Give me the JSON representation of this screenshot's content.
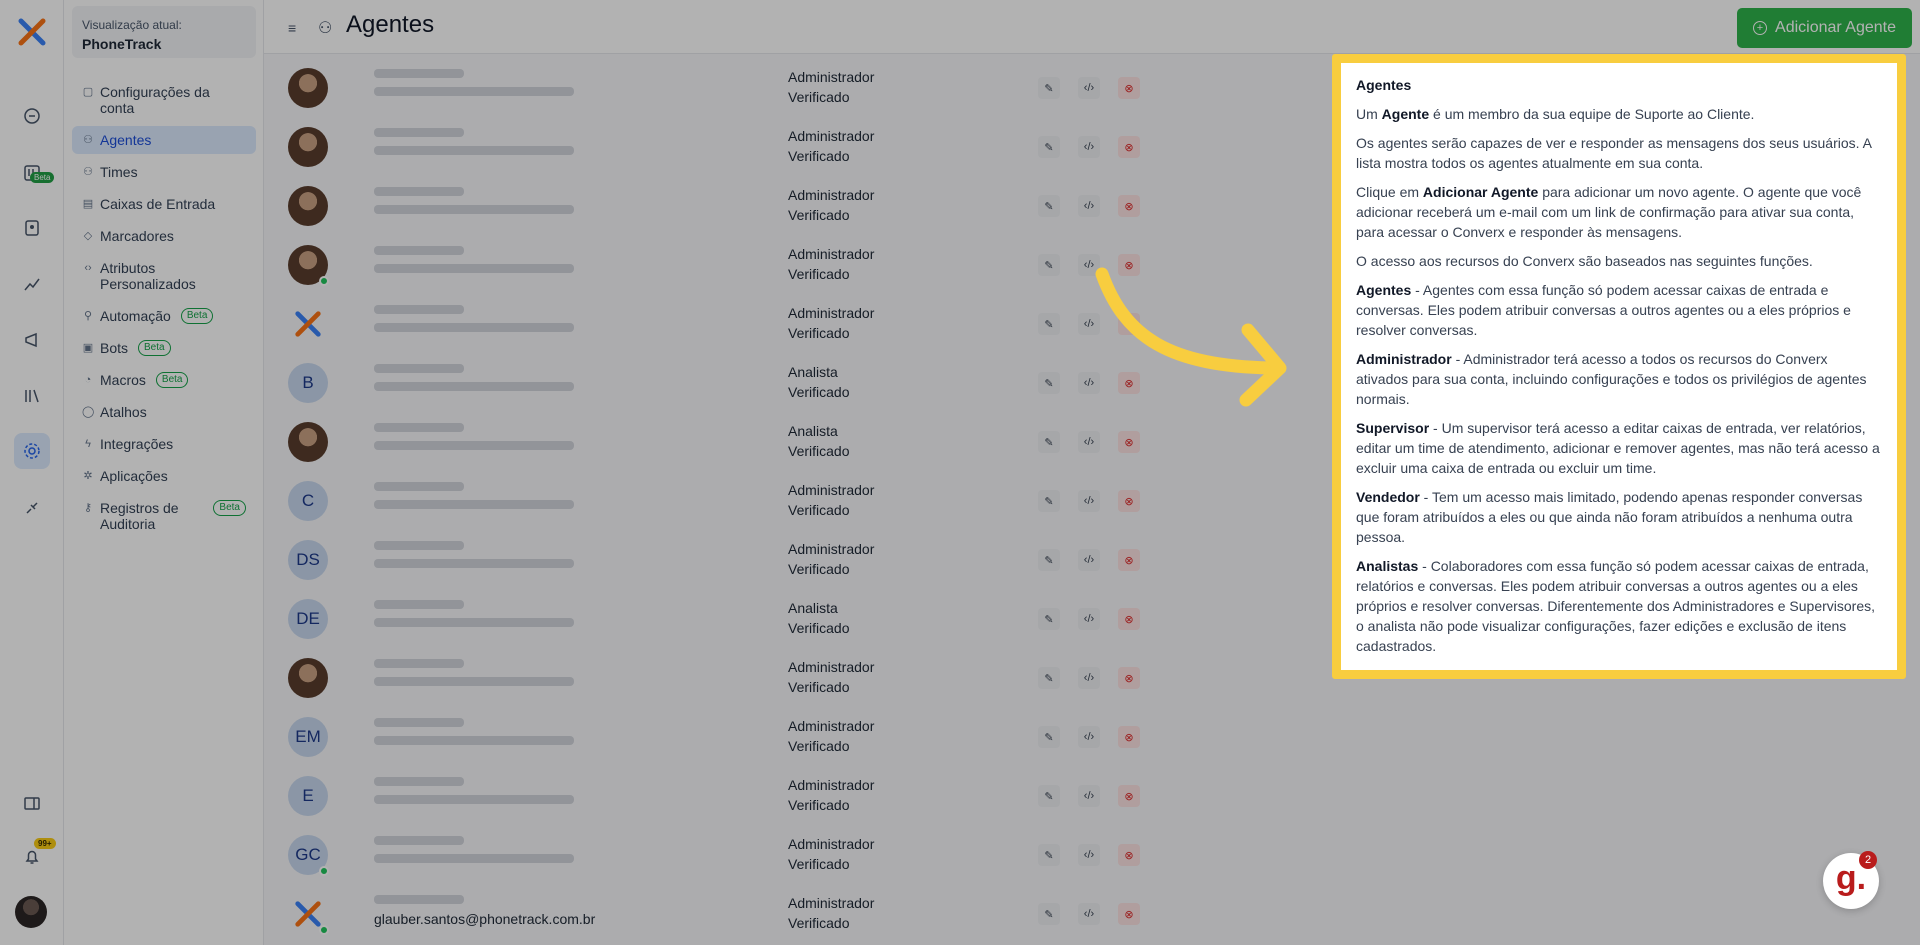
{
  "sidebar": {
    "context_label": "Visualização atual:",
    "context_value": "PhoneTrack",
    "items": [
      {
        "label": "Configurações da conta"
      },
      {
        "label": "Agentes"
      },
      {
        "label": "Times"
      },
      {
        "label": "Caixas de Entrada"
      },
      {
        "label": "Marcadores"
      },
      {
        "label": "Atributos Personalizados"
      },
      {
        "label": "Automação",
        "badge": "Beta"
      },
      {
        "label": "Bots",
        "badge": "Beta"
      },
      {
        "label": "Macros",
        "badge": "Beta"
      },
      {
        "label": "Atalhos"
      },
      {
        "label": "Integrações"
      },
      {
        "label": "Aplicações"
      },
      {
        "label": "Registros de Auditoria",
        "badge": "Beta"
      }
    ]
  },
  "rail": {
    "beta_badge": "Beta",
    "notification_count": "99+"
  },
  "header": {
    "title": "Agentes",
    "add_button": "Adicionar Agente"
  },
  "agents": [
    {
      "initials": "",
      "role": "Administrador",
      "status": "Verificado"
    },
    {
      "initials": "",
      "role": "Administrador",
      "status": "Verificado"
    },
    {
      "initials": "",
      "role": "Administrador",
      "status": "Verificado"
    },
    {
      "initials": "",
      "role": "Administrador",
      "status": "Verificado"
    },
    {
      "initials": "",
      "role": "Administrador",
      "status": "Verificado"
    },
    {
      "initials": "B",
      "role": "Analista",
      "status": "Verificado"
    },
    {
      "initials": "",
      "role": "Analista",
      "status": "Verificado"
    },
    {
      "initials": "C",
      "role": "Administrador",
      "status": "Verificado"
    },
    {
      "initials": "DS",
      "role": "Administrador",
      "status": "Verificado"
    },
    {
      "initials": "DE",
      "role": "Analista",
      "status": "Verificado"
    },
    {
      "initials": "",
      "role": "Administrador",
      "status": "Verificado"
    },
    {
      "initials": "EM",
      "role": "Administrador",
      "status": "Verificado"
    },
    {
      "initials": "E",
      "role": "Administrador",
      "status": "Verificado"
    },
    {
      "initials": "GC",
      "role": "Administrador",
      "status": "Verificado"
    },
    {
      "initials": "",
      "role": "Administrador",
      "status": "Verificado",
      "email": "glauber.santos@phonetrack.com.br"
    }
  ],
  "tooltip": {
    "title": "Agentes",
    "p1_pre": "Um ",
    "p1_bold": "Agente",
    "p1_post": " é um membro da sua equipe de Suporte ao Cliente.",
    "p2": "Os agentes serão capazes de ver e responder as mensagens dos seus usuários. A lista mostra todos os agentes atualmente em sua conta.",
    "p3_pre": "Clique em ",
    "p3_bold": "Adicionar Agente",
    "p3_post": " para adicionar um novo agente. O agente que você adicionar receberá um e-mail com um link de confirmação para ativar sua conta, para acessar o Converx e responder às mensagens.",
    "p4": "O acesso aos recursos do Converx são baseados nas seguintes funções.",
    "r1_bold": "Agentes",
    "r1_text": " - Agentes com essa função só podem acessar caixas de entrada e conversas. Eles podem atribuir conversas a outros agentes ou a eles próprios e resolver conversas.",
    "r2_bold": "Administrador",
    "r2_text": " - Administrador terá acesso a todos os recursos do Converx ativados para sua conta, incluindo configurações e todos os privilégios de agentes normais.",
    "r3_bold": "Supervisor",
    "r3_text": " - Um supervisor terá acesso a editar caixas de entrada, ver relatórios, editar um time de atendimento, adicionar e remover agentes, mas não terá acesso a excluir uma caixa de entrada ou excluir um time.",
    "r4_bold": "Vendedor",
    "r4_text": " - Tem um acesso mais limitado, podendo apenas responder conversas que foram atribuídos a eles ou que ainda não foram atribuídos a nenhuma outra pessoa.",
    "r5_bold": "Analistas",
    "r5_text": " - Colaboradores com essa função só podem acessar caixas de entrada, relatórios e conversas. Eles podem atribuir conversas a outros agentes ou a eles próprios e resolver conversas. Diferentemente dos Administradores e Supervisores, o analista não pode visualizar configurações, fazer edições e exclusão de itens cadastrados."
  },
  "chat_widget": {
    "badge": "2",
    "glyph": "g."
  },
  "colors": {
    "accent": "#2fb34b",
    "highlight_border": "#f8cd3f",
    "arrow": "#f8cd3f"
  }
}
